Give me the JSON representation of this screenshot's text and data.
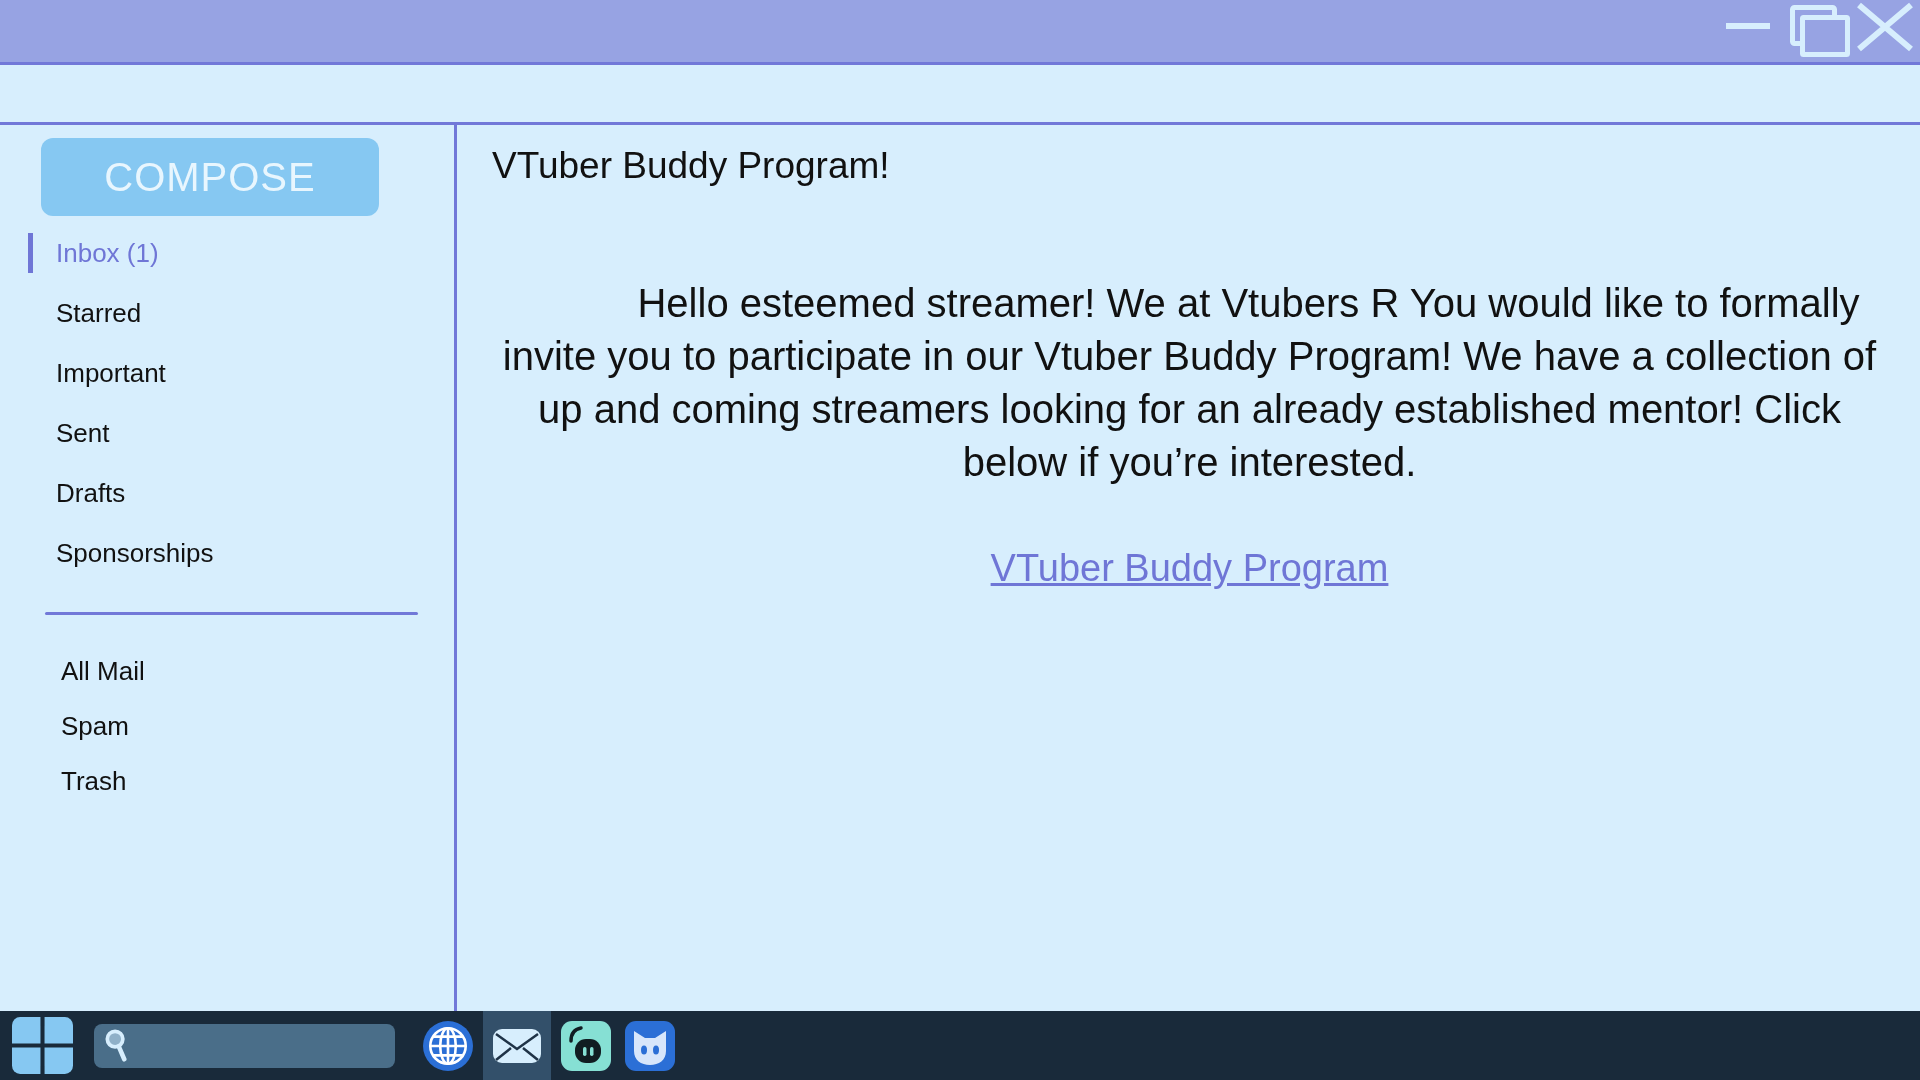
{
  "compose_button": {
    "label": "COMPOSE"
  },
  "sidebar": {
    "items": [
      {
        "label": "Inbox (1)",
        "selected": true
      },
      {
        "label": "Starred",
        "selected": false
      },
      {
        "label": "Important",
        "selected": false
      },
      {
        "label": "Sent",
        "selected": false
      },
      {
        "label": "Drafts",
        "selected": false
      },
      {
        "label": "Sponsorships",
        "selected": false
      }
    ],
    "more_items": [
      {
        "label": "All Mail",
        "selected": false
      },
      {
        "label": "Spam",
        "selected": false
      },
      {
        "label": "Trash",
        "selected": false
      }
    ]
  },
  "message": {
    "subject": "VTuber Buddy Program!",
    "body": "Hello esteemed streamer! We at Vtubers R You would like to formally invite you to participate in our Vtuber Buddy Program! We have a collection of up and coming streamers looking for an already established mentor! Click below if you’re interested.",
    "link": "VTuber Buddy Program"
  },
  "taskbar": {
    "apps": [
      {
        "kind": "browser",
        "selected": false
      },
      {
        "kind": "mail",
        "selected": true
      },
      {
        "kind": "chat",
        "selected": false
      },
      {
        "kind": "avatar",
        "selected": false
      }
    ]
  }
}
